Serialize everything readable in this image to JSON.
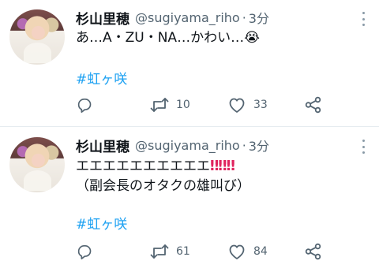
{
  "tweets": [
    {
      "author_name": "杉山里穂",
      "handle": "@sugiyama_riho",
      "separator": "·",
      "time": "3分",
      "text_lines": [
        "あ…A・ZU・NA…かわい…😭"
      ],
      "hashtag": "#虹ヶ咲",
      "replies": "",
      "retweets": "10",
      "likes": "33"
    },
    {
      "author_name": "杉山里穂",
      "handle": "@sugiyama_riho",
      "separator": "·",
      "time": "3分",
      "text_lines": [
        "エエエエエエエエエエ",
        "（副会長のオタクの雄叫び）"
      ],
      "emphasis": "‼‼‼",
      "hashtag": "#虹ヶ咲",
      "replies": "",
      "retweets": "61",
      "likes": "84"
    }
  ],
  "icons": [
    "reply-icon",
    "retweet-icon",
    "like-icon",
    "share-icon",
    "more-icon"
  ],
  "colors": {
    "hashtag": "#1da1f2",
    "muted": "#536471",
    "emphasis": "#e0245e",
    "divider": "#e6ecf0"
  }
}
